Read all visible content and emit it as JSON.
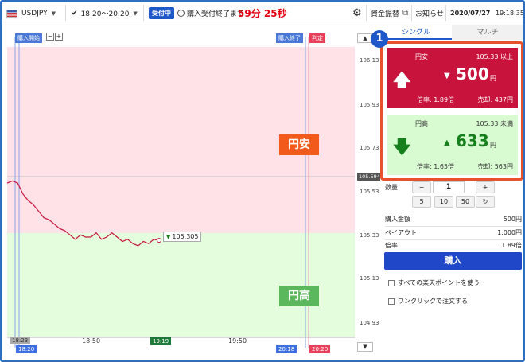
{
  "topbar": {
    "pair": "USDJPY",
    "session": "18:20〜20:20",
    "status_badge": "受付中",
    "countdown_label": "購入受付終了まで",
    "countdown": "59分 25秒",
    "funds_link": "資金振替",
    "notice": "お知らせ",
    "date": "2020/07/27",
    "time": "19:18:35"
  },
  "chart": {
    "markers": {
      "purchase_start": "購入開始",
      "purchase_end": "購入終了",
      "judgement": "判定"
    },
    "y_ticks": [
      "106.13",
      "105.93",
      "105.73",
      "105.53",
      "105.33",
      "105.13",
      "104.93"
    ],
    "current_price": "105.594",
    "zones": {
      "upper": "円安",
      "lower": "円高"
    },
    "strike_tag": "105.305",
    "x_ticks": [
      "18:50",
      "19:50"
    ],
    "x_badges": {
      "gray": "18:23",
      "start": "18:20",
      "now": "19:19",
      "end": "20:18",
      "judge": "20:20"
    },
    "colors": {
      "upper_zone": "#ffe1e8",
      "lower_zone": "#e4fddc",
      "line": "#c8143c",
      "zone_label_up": "#f25a1b",
      "zone_label_down": "#5cb85c"
    }
  },
  "chart_data": {
    "type": "line",
    "x": [
      "18:20",
      "18:22",
      "18:24",
      "18:26",
      "18:28",
      "18:30",
      "18:32",
      "18:34",
      "18:36",
      "18:38",
      "18:40",
      "18:42",
      "18:44",
      "18:46",
      "18:48",
      "18:50",
      "18:52",
      "18:54",
      "18:56",
      "18:58",
      "19:00",
      "19:02",
      "19:04",
      "19:06",
      "19:08",
      "19:10",
      "19:12",
      "19:14",
      "19:16",
      "19:18"
    ],
    "values": [
      105.57,
      105.58,
      105.57,
      105.52,
      105.49,
      105.47,
      105.44,
      105.41,
      105.4,
      105.38,
      105.36,
      105.35,
      105.33,
      105.31,
      105.33,
      105.32,
      105.32,
      105.34,
      105.31,
      105.32,
      105.34,
      105.32,
      105.3,
      105.31,
      105.29,
      105.28,
      105.3,
      105.29,
      105.31,
      105.305
    ],
    "ylim": [
      104.86,
      106.2
    ],
    "strike": 105.305
  },
  "panel": {
    "tabs": [
      "シングル",
      "マルチ"
    ],
    "step_number": "1",
    "up": {
      "label": "円安",
      "condition": "105.33 以上",
      "price": "500",
      "unit": "円",
      "rate": "倍率: 1.89倍",
      "sell": "売却: 437円"
    },
    "down": {
      "label": "円高",
      "condition": "105.33 未満",
      "price": "633",
      "unit": "円",
      "rate": "倍率: 1.65倍",
      "sell": "売却: 563円"
    },
    "qty_label": "数量",
    "qty_minus": "−",
    "qty_value": "1",
    "qty_plus": "+",
    "presets": [
      "5",
      "10",
      "50"
    ],
    "refresh": "↻",
    "rows": [
      {
        "label": "購入金額",
        "value": "500円"
      },
      {
        "label": "ペイアウト",
        "value": "1,000円"
      },
      {
        "label": "倍率",
        "value": "1.89倍"
      }
    ],
    "buy_label": "購入",
    "check_points": "すべての楽天ポイントを使う",
    "check_oneclick": "ワンクリックで注文する"
  }
}
